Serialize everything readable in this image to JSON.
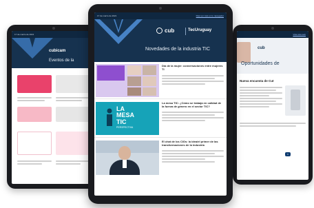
{
  "left": {
    "topbar_date": "17 de marzo de 2021",
    "topbar_link": "",
    "brand": "cubicam",
    "banner_title": "Eventos de la"
  },
  "center": {
    "topbar_date": "17 de marzo de 2021",
    "topbar_link": "Para ver más en tu navegador",
    "brand_cub": "cub",
    "brand_tec": "TecUruguay",
    "banner_title": "Novedades de la industria TIC",
    "articles": [
      {
        "headline": "Día de la mujer: conversaciones entre mujeres TI",
        "thumb": "collage"
      },
      {
        "headline": "La mesa TIC: ¿Cómo se trabaja en calidad de la fuerza de género en el sector TIC?",
        "thumb": "lamesa"
      },
      {
        "headline": "El chat de los CIOs: la idea/el primer de las transformaciones de la industria",
        "thumb": "portrait"
      }
    ],
    "lamesa": {
      "line1": "LA",
      "line2": "MESA",
      "line3": "TIC",
      "line4": "PERSPECTIVA"
    }
  },
  "right": {
    "topbar_link": "Vista tela web",
    "brand": "cub",
    "banner_title": "Oportunidades de",
    "section_title": "Nueva encuesta de Cut",
    "cta": "Ir"
  },
  "colors": {
    "navy": "#16324f",
    "accent_teal": "#16a3b8",
    "accent_pink": "#e9426b",
    "accent_blue": "#0f3c70"
  }
}
